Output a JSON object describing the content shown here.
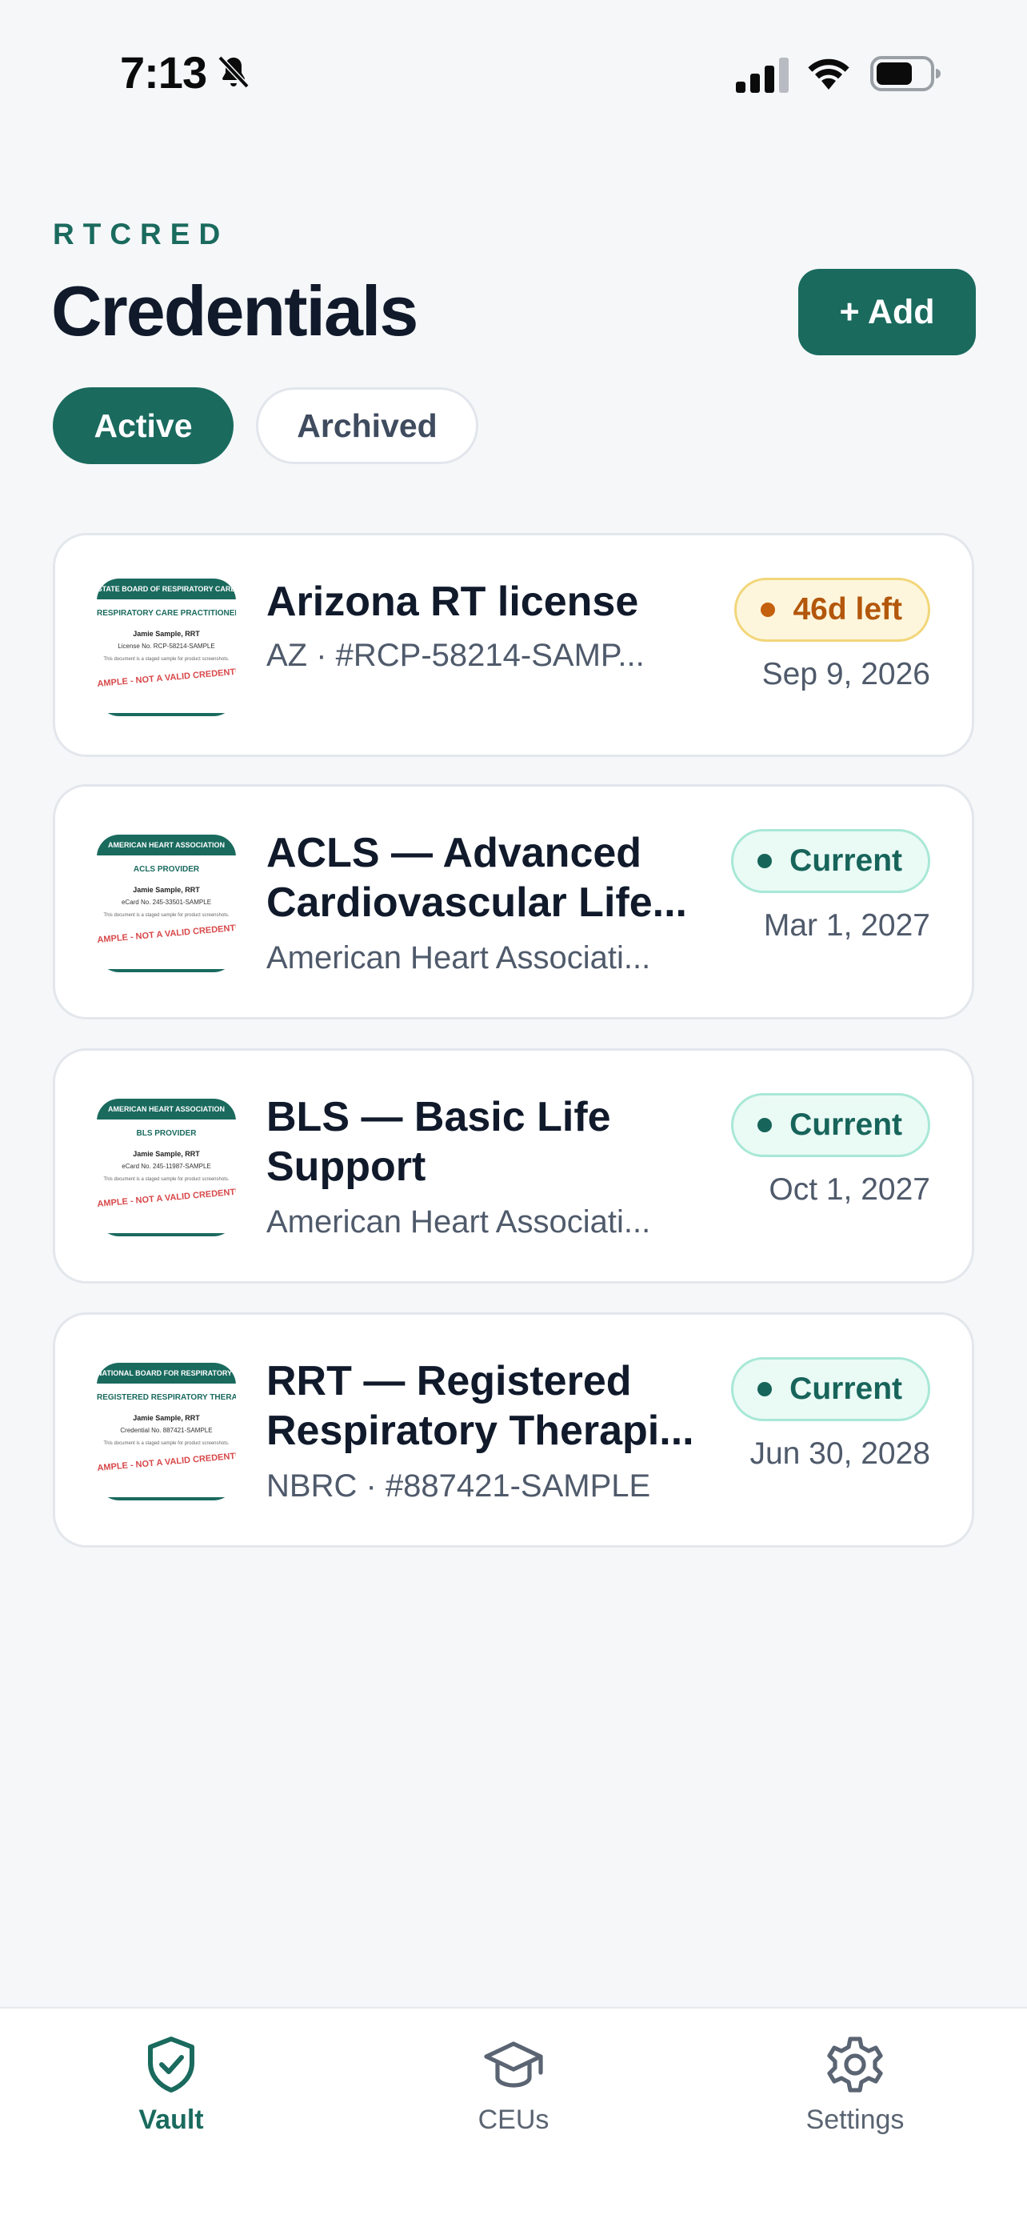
{
  "status_bar": {
    "time": "7:13"
  },
  "header": {
    "brand": "RTCRED",
    "title": "Credentials",
    "add_label": "+ Add"
  },
  "tabs": [
    {
      "label": "Active"
    },
    {
      "label": "Archived"
    }
  ],
  "credentials": [
    {
      "title": "Arizona RT license",
      "subtitle": "AZ · #RCP-58214-SAMP...",
      "badge": "46d left",
      "date": "Sep 9, 2026",
      "thumb": {
        "header": "STATE BOARD OF RESPIRATORY CARE",
        "sub": "RESPIRATORY CARE PRACTITIONER LICENSE",
        "name": "Jamie Sample, RRT",
        "number": "License No. RCP-58214-SAMPLE",
        "fine": "This document is a staged sample for product screenshots.",
        "stamp": "SAMPLE - NOT A VALID CREDENTIAL"
      }
    },
    {
      "title": "ACLS — Advanced Cardiovascular Life...",
      "subtitle": "American Heart Associati...",
      "badge": "Current",
      "date": "Mar 1, 2027",
      "thumb": {
        "header": "AMERICAN HEART ASSOCIATION",
        "sub": "ACLS PROVIDER",
        "name": "Jamie Sample, RRT",
        "number": "eCard No. 245-33501-SAMPLE",
        "fine": "This document is a staged sample for product screenshots.",
        "stamp": "SAMPLE - NOT A VALID CREDENTIAL"
      }
    },
    {
      "title": "BLS — Basic Life Support",
      "subtitle": "American Heart Associati...",
      "badge": "Current",
      "date": "Oct 1, 2027",
      "thumb": {
        "header": "AMERICAN HEART ASSOCIATION",
        "sub": "BLS PROVIDER",
        "name": "Jamie Sample, RRT",
        "number": "eCard No. 245-11987-SAMPLE",
        "fine": "This document is a staged sample for product screenshots.",
        "stamp": "SAMPLE - NOT A VALID CREDENTIAL"
      }
    },
    {
      "title": "RRT — Registered Respiratory Therapi...",
      "subtitle": "NBRC · #887421-SAMPLE",
      "badge": "Current",
      "date": "Jun 30, 2028",
      "thumb": {
        "header": "NATIONAL BOARD FOR RESPIRATORY CARE",
        "sub": "REGISTERED RESPIRATORY THERAPIST",
        "name": "Jamie Sample, RRT",
        "number": "Credential No. 887421-SAMPLE",
        "fine": "This document is a staged sample for product screenshots.",
        "stamp": "SAMPLE - NOT A VALID CREDENTIAL"
      }
    }
  ],
  "bottom_nav": [
    {
      "label": "Vault",
      "icon": "shield-check-icon",
      "active": true
    },
    {
      "label": "CEUs",
      "icon": "graduation-cap-icon",
      "active": false
    },
    {
      "label": "Settings",
      "icon": "gear-icon",
      "active": false
    }
  ],
  "colors": {
    "accent": "#1a6a5e",
    "warning": "#b3570c",
    "background": "#f5f7f9"
  }
}
